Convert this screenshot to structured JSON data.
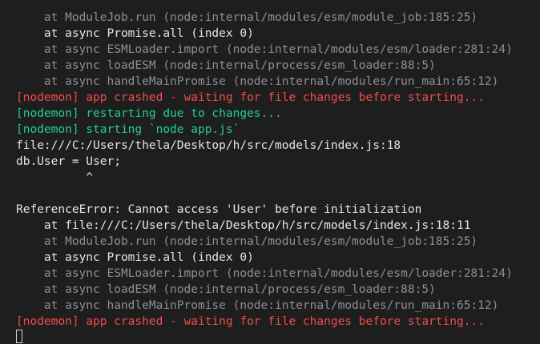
{
  "terminal": {
    "lines": [
      {
        "text": "    at ModuleJob.run (node:internal/modules/esm/module_job:185:25)",
        "color": "dim"
      },
      {
        "text": "    at async Promise.all (index 0)",
        "color": "white"
      },
      {
        "text": "    at async ESMLoader.import (node:internal/modules/esm/loader:281:24)",
        "color": "dim"
      },
      {
        "text": "    at async loadESM (node:internal/process/esm_loader:88:5)",
        "color": "dim"
      },
      {
        "text": "    at async handleMainPromise (node:internal/modules/run_main:65:12)",
        "color": "dim"
      },
      {
        "text": "[nodemon] app crashed - waiting for file changes before starting...",
        "color": "red"
      },
      {
        "text": "[nodemon] restarting due to changes...",
        "color": "green"
      },
      {
        "text": "[nodemon] starting `node app.js`",
        "color": "green"
      },
      {
        "text": "file:///C:/Users/thela/Desktop/h/src/models/index.js:18",
        "color": "white"
      },
      {
        "text": "db.User = User;",
        "color": "white"
      },
      {
        "text": "          ^",
        "color": "white"
      },
      {
        "text": "",
        "color": "white"
      },
      {
        "text": "ReferenceError: Cannot access 'User' before initialization",
        "color": "white"
      },
      {
        "text": "    at file:///C:/Users/thela/Desktop/h/src/models/index.js:18:11",
        "color": "white"
      },
      {
        "text": "    at ModuleJob.run (node:internal/modules/esm/module_job:185:25)",
        "color": "dim"
      },
      {
        "text": "    at async Promise.all (index 0)",
        "color": "white"
      },
      {
        "text": "    at async ESMLoader.import (node:internal/modules/esm/loader:281:24)",
        "color": "dim"
      },
      {
        "text": "    at async loadESM (node:internal/process/esm_loader:88:5)",
        "color": "dim"
      },
      {
        "text": "    at async handleMainPromise (node:internal/modules/run_main:65:12)",
        "color": "dim"
      },
      {
        "text": "[nodemon] app crashed - waiting for file changes before starting...",
        "color": "red"
      }
    ],
    "colors": {
      "background": "#1e1e1e",
      "dim": "#8f8f8f",
      "white": "#e5e5e5",
      "red": "#f14c4c",
      "green": "#23d18b"
    }
  }
}
